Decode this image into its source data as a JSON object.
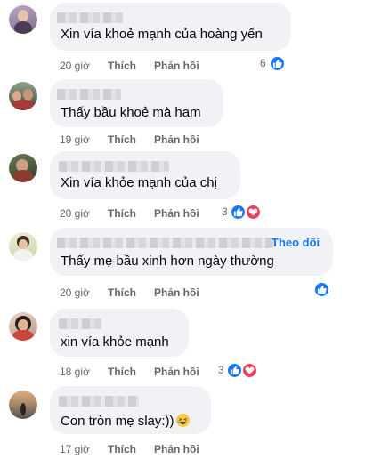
{
  "comments": [
    {
      "text": "Xin vía khoẻ mạnh của hoàng yến",
      "time": "20 giờ",
      "like_label": "Thích",
      "reply_label": "Phản hồi",
      "reaction_count": "6",
      "reactions": [
        "like-icon"
      ]
    },
    {
      "text": "Thấy bầu khoẻ mà ham",
      "time": "19 giờ",
      "like_label": "Thích",
      "reply_label": "Phản hồi"
    },
    {
      "text": "Xin vía khỏe mạnh của chị",
      "time": "20 giờ",
      "like_label": "Thích",
      "reply_label": "Phản hồi",
      "reaction_count": "3",
      "reactions": [
        "like-icon",
        "love-icon"
      ]
    },
    {
      "text": "Thấy mẹ bầu xinh hơn ngày thường",
      "follow_label": "Theo dõi",
      "time": "20 giờ",
      "like_label": "Thích",
      "reply_label": "Phản hồi",
      "reactions": [
        "like-icon"
      ]
    },
    {
      "text": "xin vía khỏe mạnh",
      "time": "18 giờ",
      "like_label": "Thích",
      "reply_label": "Phản hồi",
      "reaction_count": "3",
      "reactions": [
        "like-icon",
        "love-icon"
      ]
    },
    {
      "text": "Con tròn mẹ slay:))",
      "emoji": "laughing-emoji",
      "time": "17 giờ",
      "like_label": "Thích",
      "reply_label": "Phản hồi"
    }
  ],
  "colors": {
    "bubble": "#f0f2f5",
    "like": "#1877f2",
    "love": "#f33e58",
    "meta_text": "#65676b"
  }
}
